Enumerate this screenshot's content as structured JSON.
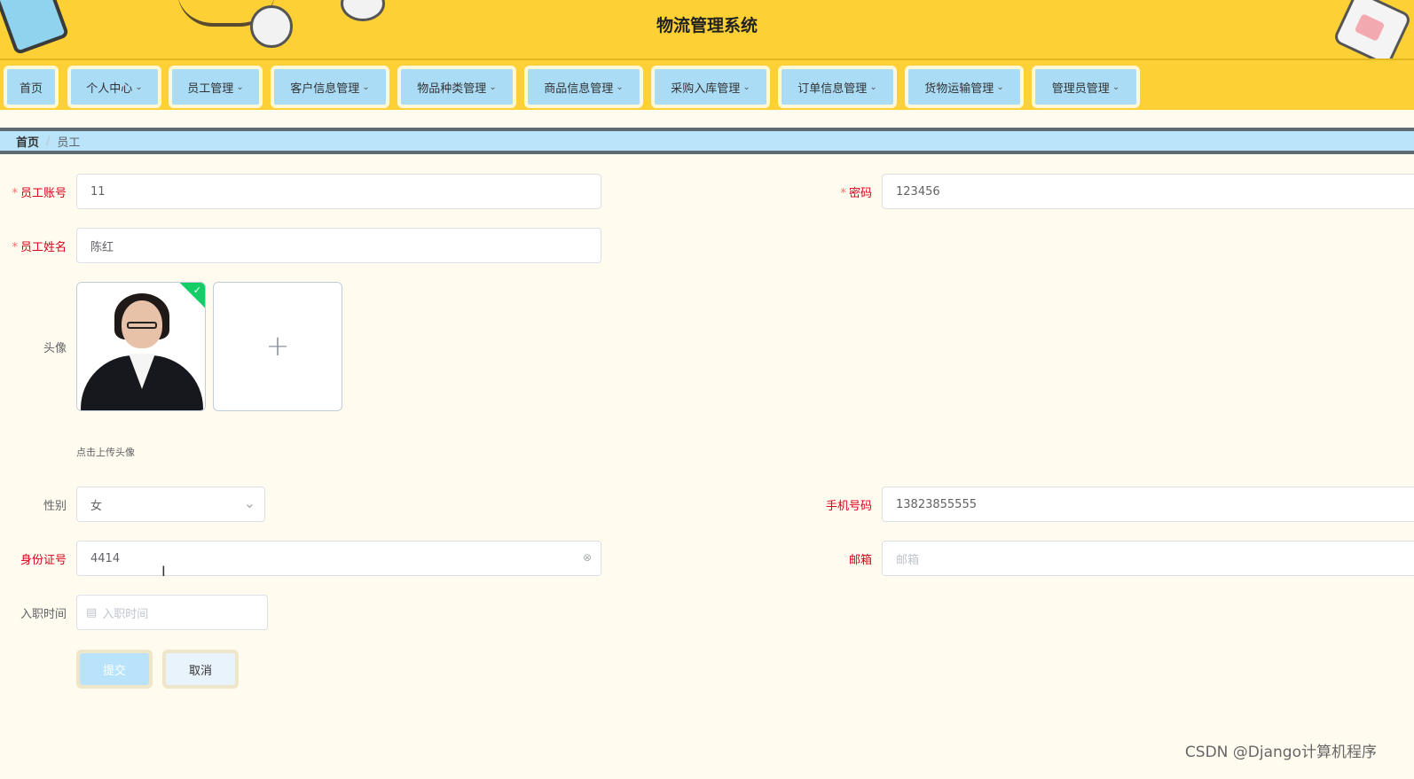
{
  "header": {
    "title": "物流管理系统",
    "bg_color": "#fdd135"
  },
  "nav": {
    "items": [
      {
        "label": "首页",
        "has_dropdown": false
      },
      {
        "label": "个人中心",
        "has_dropdown": true
      },
      {
        "label": "员工管理",
        "has_dropdown": true
      },
      {
        "label": "客户信息管理",
        "has_dropdown": true
      },
      {
        "label": "物品种类管理",
        "has_dropdown": true
      },
      {
        "label": "商品信息管理",
        "has_dropdown": true
      },
      {
        "label": "采购入库管理",
        "has_dropdown": true
      },
      {
        "label": "订单信息管理",
        "has_dropdown": true
      },
      {
        "label": "货物运输管理",
        "has_dropdown": true
      },
      {
        "label": "管理员管理",
        "has_dropdown": true
      }
    ],
    "chevron_icon": "⌄"
  },
  "breadcrumb": {
    "home": "首页",
    "separator": "/",
    "current": "员工"
  },
  "form": {
    "account": {
      "label": "员工账号",
      "value": "11",
      "required": true
    },
    "password": {
      "label": "密码",
      "value": "123456",
      "required": true
    },
    "name": {
      "label": "员工姓名",
      "value": "陈红",
      "required": true
    },
    "avatar": {
      "label": "头像",
      "tip": "点击上传头像",
      "plus": "+",
      "check": "✓"
    },
    "gender": {
      "label": "性别",
      "value": "女",
      "chevron": "⌄"
    },
    "phone": {
      "label": "手机号码",
      "value": "13823855555"
    },
    "id_card": {
      "label": "身份证号",
      "value": "4414",
      "clear_icon": "⊗"
    },
    "email": {
      "label": "邮箱",
      "placeholder": "邮箱"
    },
    "hire_date": {
      "label": "入职时间",
      "placeholder": "入职时间",
      "calendar_icon": "▤"
    },
    "required_star": "*"
  },
  "buttons": {
    "submit": "提交",
    "cancel": "取消"
  },
  "watermark": "CSDN @Django计算机程序",
  "cursor": "I"
}
